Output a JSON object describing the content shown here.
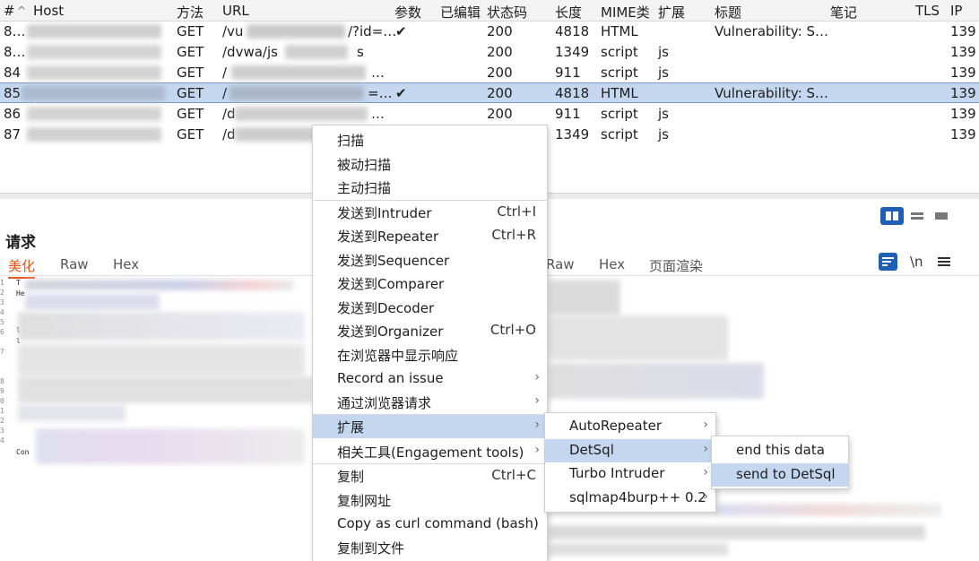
{
  "table": {
    "columns": [
      "#",
      "Host",
      "方法",
      "URL",
      "参数",
      "已编辑",
      "状态码",
      "长度",
      "MIME类",
      "扩展",
      "标题",
      "笔记",
      "TLS",
      "IP"
    ],
    "rows": [
      {
        "num": "8…",
        "method": "GET",
        "url": "/vu",
        "url_tail": "/?id=…",
        "params": "✔",
        "status": "200",
        "length": "4818",
        "mime": "HTML",
        "ext": "",
        "title": "Vulnerability: S…",
        "ip": "139",
        "selected": false
      },
      {
        "num": "8…",
        "method": "GET",
        "url": "/dvwa/js",
        "url_tail": "s",
        "params": "",
        "status": "200",
        "length": "1349",
        "mime": "script",
        "ext": "js",
        "title": "",
        "ip": "139",
        "selected": false
      },
      {
        "num": "84",
        "method": "GET",
        "url": "/",
        "url_tail": "…",
        "params": "",
        "status": "200",
        "length": "911",
        "mime": "script",
        "ext": "js",
        "title": "",
        "ip": "139",
        "selected": false
      },
      {
        "num": "85",
        "method": "GET",
        "url": "/",
        "url_tail": "=…",
        "params": "✔",
        "status": "200",
        "length": "4818",
        "mime": "HTML",
        "ext": "",
        "title": "Vulnerability: S…",
        "ip": "139",
        "selected": true
      },
      {
        "num": "86",
        "method": "GET",
        "url": "/d",
        "url_tail": "…",
        "params": "",
        "status": "200",
        "length": "911",
        "mime": "script",
        "ext": "js",
        "title": "",
        "ip": "139",
        "selected": false
      },
      {
        "num": "87",
        "method": "GET",
        "url": "/d",
        "url_tail": "…",
        "params": "",
        "status": "",
        "length": "1349",
        "mime": "script",
        "ext": "js",
        "title": "",
        "ip": "139",
        "selected": false
      }
    ]
  },
  "request": {
    "title": "请求",
    "tabs": [
      "美化",
      "Raw",
      "Hex"
    ],
    "gutter": [
      "1",
      "2",
      "3",
      "4",
      "5",
      "6",
      "",
      "7",
      "",
      "",
      "8",
      "9",
      "0",
      "1",
      "2",
      "3",
      "4"
    ],
    "gutter_snips": {
      "line1": "T",
      "line2": "He",
      "line5": "l",
      "line6": "l",
      "line12": "Con"
    }
  },
  "response": {
    "tabs": [
      "Raw",
      "Hex",
      "页面渲染"
    ],
    "wrap_glyph": "\\n"
  },
  "context_menu": {
    "items": [
      {
        "label": "扫描",
        "shortcut": "",
        "submenu": false
      },
      {
        "label": "被动扫描",
        "shortcut": "",
        "submenu": false
      },
      {
        "label": "主动扫描",
        "shortcut": "",
        "submenu": false
      },
      {
        "label": "发送到Intruder",
        "shortcut": "Ctrl+I",
        "submenu": false
      },
      {
        "label": "发送到Repeater",
        "shortcut": "Ctrl+R",
        "submenu": false
      },
      {
        "label": "发送到Sequencer",
        "shortcut": "",
        "submenu": false
      },
      {
        "label": "发送到Comparer",
        "shortcut": "",
        "submenu": false
      },
      {
        "label": "发送到Decoder",
        "shortcut": "",
        "submenu": false
      },
      {
        "label": "发送到Organizer",
        "shortcut": "Ctrl+O",
        "submenu": false
      },
      {
        "label": "在浏览器中显示响应",
        "shortcut": "",
        "submenu": false
      },
      {
        "label": "Record an issue",
        "shortcut": "",
        "submenu": true
      },
      {
        "label": "通过浏览器请求",
        "shortcut": "",
        "submenu": true
      },
      {
        "label": "扩展",
        "shortcut": "",
        "submenu": true,
        "highlighted": true
      },
      {
        "label": "相关工具(Engagement tools)",
        "shortcut": "",
        "submenu": true
      },
      {
        "label": "复制",
        "shortcut": "Ctrl+C",
        "submenu": false
      },
      {
        "label": "复制网址",
        "shortcut": "",
        "submenu": false
      },
      {
        "label": "Copy as curl command (bash)",
        "shortcut": "",
        "submenu": false
      },
      {
        "label": "复制到文件",
        "shortcut": "",
        "submenu": false
      }
    ],
    "arrow_glyph": "›"
  },
  "ext_menu": {
    "items": [
      {
        "label": "AutoRepeater",
        "submenu": true
      },
      {
        "label": "DetSql",
        "submenu": true,
        "highlighted": true
      },
      {
        "label": "Turbo Intruder",
        "submenu": true
      },
      {
        "label": "sqlmap4burp++ 0.2",
        "submenu": true
      }
    ]
  },
  "detsql_menu": {
    "items": [
      {
        "label": "end this data"
      },
      {
        "label": "send to DetSql",
        "highlighted": true
      }
    ]
  },
  "colors": {
    "accent": "#e8551b",
    "selection": "#c5d7ee",
    "icon_blue": "#1f5fb5"
  },
  "icons": [
    "split-view-icon",
    "horizontal-view-icon",
    "single-view-icon",
    "word-wrap-icon",
    "newline-icon",
    "hamburger-menu-icon"
  ]
}
